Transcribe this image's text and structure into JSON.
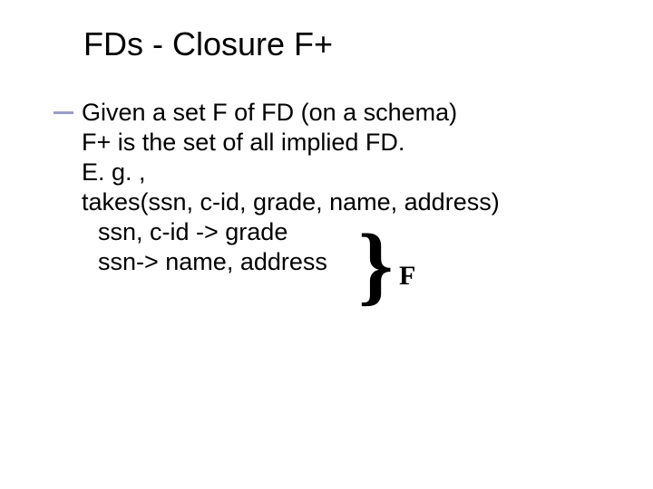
{
  "slide": {
    "title": "FDs - Closure F+",
    "lines": {
      "l1": "Given a set F of FD (on a schema)",
      "l2": "F+ is the set of all implied FD.",
      "l3": "E. g. ,",
      "l4": "takes(ssn, c-id, grade, name, address)",
      "l5": "ssn, c-id -> grade",
      "l6": "ssn-> name, address"
    },
    "brace_label": "F"
  }
}
